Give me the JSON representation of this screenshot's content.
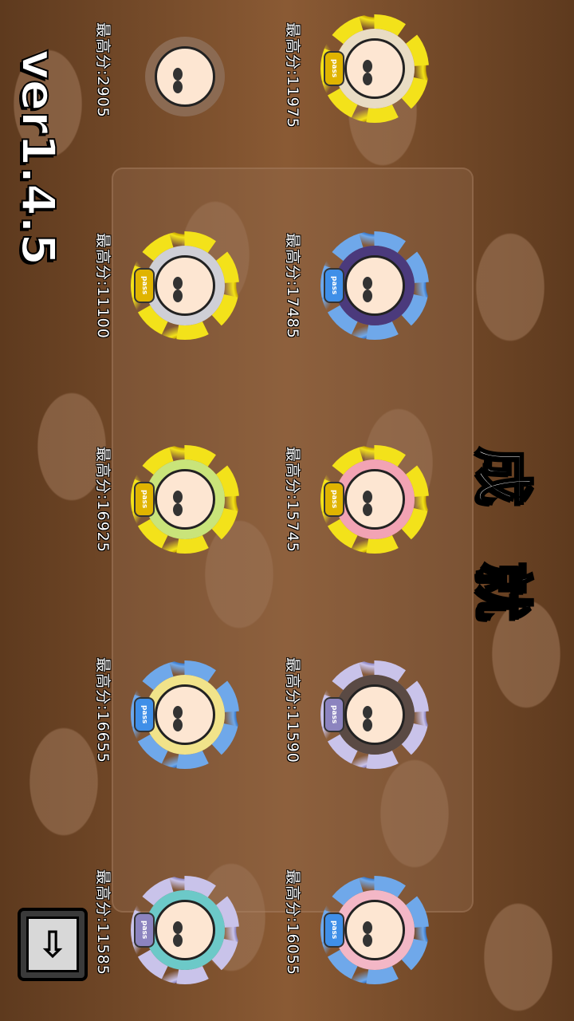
{
  "title": "成 就",
  "version": "ver1.4.5",
  "score_prefix": "最高分:",
  "achievements": [
    {
      "score": "11975",
      "wreath": "gold",
      "pass_label": "pass",
      "hair": "#e9dcc4"
    },
    {
      "score": "2905",
      "wreath": "none",
      "pass_label": "",
      "hair": "#8b6a52"
    },
    {
      "score": "17485",
      "wreath": "blue",
      "pass_label": "pass",
      "hair": "#4b3a7c"
    },
    {
      "score": "11100",
      "wreath": "gold",
      "pass_label": "pass",
      "hair": "#cfcfd6"
    },
    {
      "score": "15745",
      "wreath": "gold",
      "pass_label": "pass",
      "hair": "#f2a3b4"
    },
    {
      "score": "16925",
      "wreath": "gold",
      "pass_label": "pass",
      "hair": "#c9e47a"
    },
    {
      "score": "11590",
      "wreath": "lilac",
      "pass_label": "pass",
      "hair": "#5a4a44"
    },
    {
      "score": "16655",
      "wreath": "blue",
      "pass_label": "pass",
      "hair": "#f1e38a"
    },
    {
      "score": "16055",
      "wreath": "blue",
      "pass_label": "pass",
      "hair": "#f3b7c6"
    },
    {
      "score": "11585",
      "wreath": "lilac",
      "pass_label": "pass",
      "hair": "#6cc9c8"
    }
  ],
  "scroll_button": {
    "icon": "down-arrow-icon",
    "glyph": "⇩"
  }
}
